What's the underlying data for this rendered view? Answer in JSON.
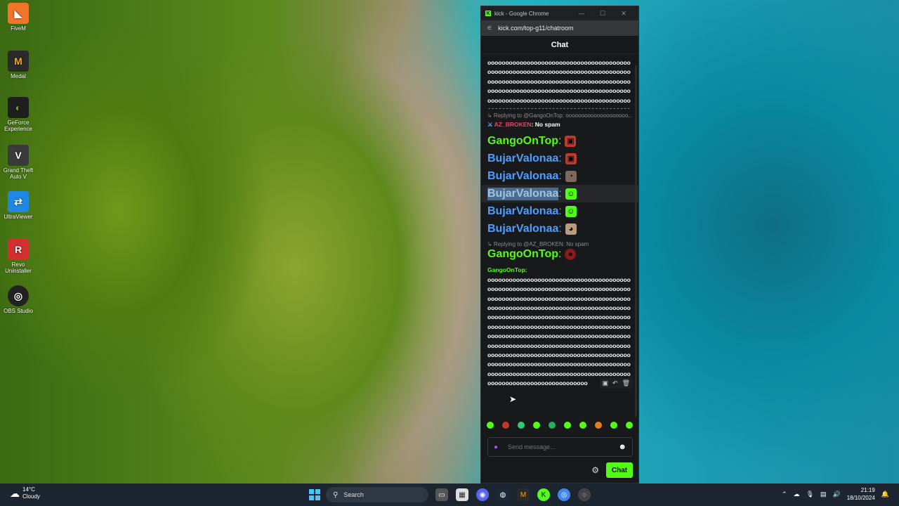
{
  "desktop": {
    "icons": [
      {
        "label": "FiveM",
        "glyph": "◣"
      },
      {
        "label": "Medal",
        "glyph": "M"
      },
      {
        "label": "GeForce Experience",
        "glyph": "◐"
      },
      {
        "label": "Grand Theft Auto V",
        "glyph": "V"
      },
      {
        "label": "UltraViewer",
        "glyph": "⇄"
      },
      {
        "label": "Revo Uninstaller",
        "glyph": "R"
      },
      {
        "label": "OBS Studio",
        "glyph": "◎"
      }
    ]
  },
  "browser": {
    "title": "kick - Google Chrome",
    "url": "kick.com/top-g11/chatroom"
  },
  "chat": {
    "header": "Chat",
    "spam_line_1": "oooooooooooooooooooooooooooooooooooooooooooooooooooooooooooooooooooooooooooooooooooooooooooooooooooooooooooooooooooooooooooooooooooooooooooooooooooooooooooooooooooooooooooooooooooooooooooooooooooooooooooooooooooooooooooooooooooooooooooooooooooooooooo",
    "reply_1": "↳ Replying to @GangoOnTop: oooooooooooooooooooo...",
    "mod_name": "AZ_BROKEN",
    "mod_text": "No spam",
    "rows": [
      {
        "user": "GangoOnTop",
        "color": "#53fc18"
      },
      {
        "user": "BujarValonaa",
        "color": "#4f9dff"
      },
      {
        "user": "BujarValonaa",
        "color": "#4f9dff"
      },
      {
        "user": "BujarValonaa",
        "color": "#4f9dff"
      },
      {
        "user": "BujarValonaa",
        "color": "#4f9dff"
      },
      {
        "user": "BujarValonaa",
        "color": "#4f9dff"
      }
    ],
    "reply_2": "↳ Replying to @AZ_BROKEN: No spam",
    "user_gango": "GangoOnTop",
    "user_gango_2": "GangoOnTop",
    "spam_line_2": "oooooooooooooooooooooooooooooooooooooooooooooooooooooooooooooooooooooooooooooooooooooooooooooooooooooooooooooooooooooooooooooooooooooooooooooooooooooooooooooooooooooooooooooooooooooooooooooooooooooooooooooooooooooooooooooooooooooooooooooooooooooooooooooooooooooooooooooooooooooooooooooooooooooooooooooooooooooooooooooooooooooooooooooooooooooooooooooooooooooooooooooooooooooooooooooooooooooooooooooooooooooooooooooooooooooooooooooooooooooooooooooooooooooooooooooooooooo",
    "placeholder": "Send message...",
    "chat_button": "Chat"
  },
  "taskbar": {
    "temp": "14°C",
    "condition": "Cloudy",
    "search": "Search",
    "time": "21:19",
    "date": "18/10/2024"
  }
}
